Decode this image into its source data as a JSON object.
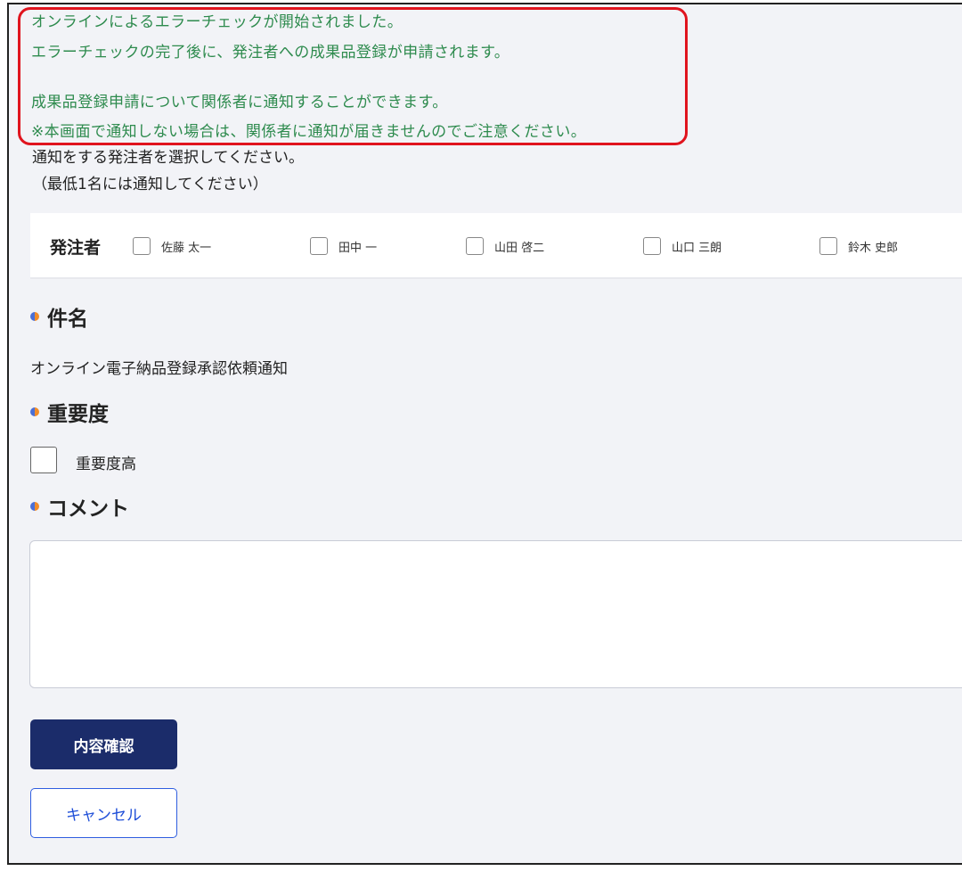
{
  "notice": {
    "lines": [
      "オンラインによるエラーチェックが開始されました。",
      "エラーチェックの完了後に、発注者への成果品登録が申請されます。",
      "",
      "成果品登録申請について関係者に通知することができます。",
      "※本画面で通知しない場合は、関係者に通知が届きませんのでご注意ください。"
    ],
    "text_color": "#2e8b4e",
    "border_color": "#e0141e"
  },
  "instructions": [
    "通知をする発注者を選択してください。",
    "（最低1名には通知してください）"
  ],
  "recipients": {
    "label": "発注者",
    "options": [
      {
        "name": "佐藤 太一",
        "checked": false
      },
      {
        "name": "田中 一",
        "checked": false
      },
      {
        "name": "山田 啓二",
        "checked": false
      },
      {
        "name": "山口 三朗",
        "checked": false
      },
      {
        "name": "鈴木 史郎",
        "checked": false
      }
    ]
  },
  "subject": {
    "heading": "件名",
    "value": "オンライン電子納品登録承認依頼通知"
  },
  "importance": {
    "heading": "重要度",
    "checkbox_label": "重要度高",
    "checked": false
  },
  "comment": {
    "heading": "コメント",
    "value": ""
  },
  "buttons": {
    "confirm": "内容確認",
    "cancel": "キャンセル"
  },
  "colors": {
    "primary": "#1b2c6a",
    "secondary_text": "#1e4ed8",
    "background": "#f2f3f7"
  }
}
